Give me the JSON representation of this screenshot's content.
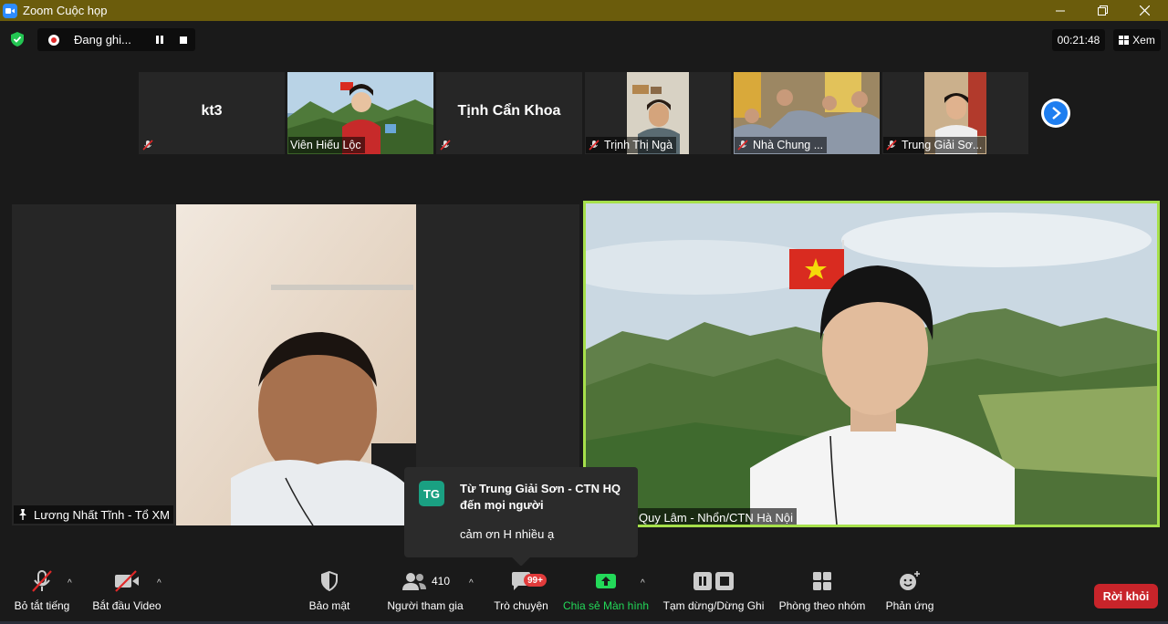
{
  "window": {
    "title": "Zoom Cuộc họp"
  },
  "recording": {
    "label": "Đang ghi..."
  },
  "header": {
    "timer": "00:21:48",
    "view_label": "Xem"
  },
  "gallery": [
    {
      "name": "kt3",
      "label": ""
    },
    {
      "name": "",
      "label": "Viên Hiếu Lộc"
    },
    {
      "name": "Tịnh Cẩn Khoa",
      "label": ""
    },
    {
      "name": "",
      "label": "Trịnh Thị Ngà"
    },
    {
      "name": "",
      "label": "Nhà Chung ..."
    },
    {
      "name": "",
      "label": "Trung Giải Sơ..."
    }
  ],
  "main": {
    "left_label": "Lương Nhất Tĩnh - Tổ XM",
    "right_label": "Quy Lâm - Nhổn/CTN Hà Nội"
  },
  "chat_popup": {
    "avatar": "TG",
    "from": "Từ Trung Giải Sơn - CTN HQ đến mọi người",
    "message": "cảm ơn H nhiều ạ"
  },
  "toolbar": {
    "unmute": "Bỏ tắt tiếng",
    "start_video": "Bắt đầu Video",
    "security": "Bảo mật",
    "participants": "Người tham gia",
    "participants_count": "410",
    "chat": "Trò chuyện",
    "chat_badge": "99+",
    "share": "Chia sẻ Màn hình",
    "pause_record": "Tạm dừng/Dừng Ghi",
    "breakout": "Phòng theo nhóm",
    "reactions": "Phản ứng",
    "leave": "Rời khỏi"
  },
  "colors": {
    "titlebar": "#6b5c0c",
    "active_speaker_border": "#a6e04b",
    "share_green": "#23d959",
    "leave_red": "#c8242a",
    "mute_red": "#e02828"
  }
}
